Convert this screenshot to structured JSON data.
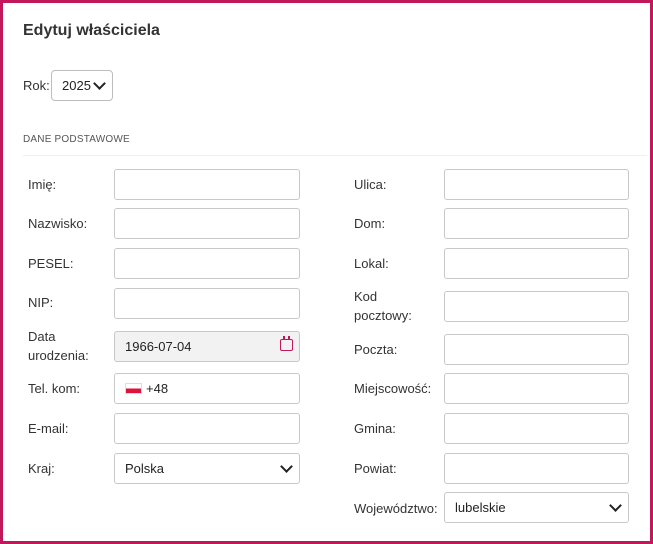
{
  "title": "Edytuj właściciela",
  "year": {
    "label": "Rok:",
    "value": "2025"
  },
  "section_title": "DANE PODSTAWOWE",
  "left": {
    "imie": {
      "label": "Imię:",
      "value": ""
    },
    "nazwisko": {
      "label": "Nazwisko:",
      "value": ""
    },
    "pesel": {
      "label": "PESEL:",
      "value": ""
    },
    "nip": {
      "label": "NIP:",
      "value": ""
    },
    "data_urodzenia": {
      "label_1": "Data",
      "label_2": "urodzenia:",
      "value": "1966-07-04"
    },
    "tel": {
      "label": "Tel. kom:",
      "prefix": "+48",
      "value": ""
    },
    "email": {
      "label": "E-mail:",
      "value": ""
    },
    "kraj": {
      "label": "Kraj:",
      "value": "Polska"
    }
  },
  "right": {
    "ulica": {
      "label": "Ulica:",
      "value": ""
    },
    "dom": {
      "label": "Dom:",
      "value": ""
    },
    "lokal": {
      "label": "Lokal:",
      "value": ""
    },
    "kod": {
      "label_1": "Kod",
      "label_2": "pocztowy:",
      "value": ""
    },
    "poczta": {
      "label": "Poczta:",
      "value": ""
    },
    "miejscowosc": {
      "label": "Miejscowość:",
      "value": ""
    },
    "gmina": {
      "label": "Gmina:",
      "value": ""
    },
    "powiat": {
      "label": "Powiat:",
      "value": ""
    },
    "wojewodztwo": {
      "label": "Województwo:",
      "value": "lubelskie"
    }
  },
  "colors": {
    "accent": "#c2185b",
    "border": "#c8c8c8",
    "disabled_bg": "#f2f2f2"
  },
  "icons": {
    "date": "calendar-icon",
    "phone_country": "poland-flag-icon",
    "dropdown": "chevron-down-icon"
  }
}
